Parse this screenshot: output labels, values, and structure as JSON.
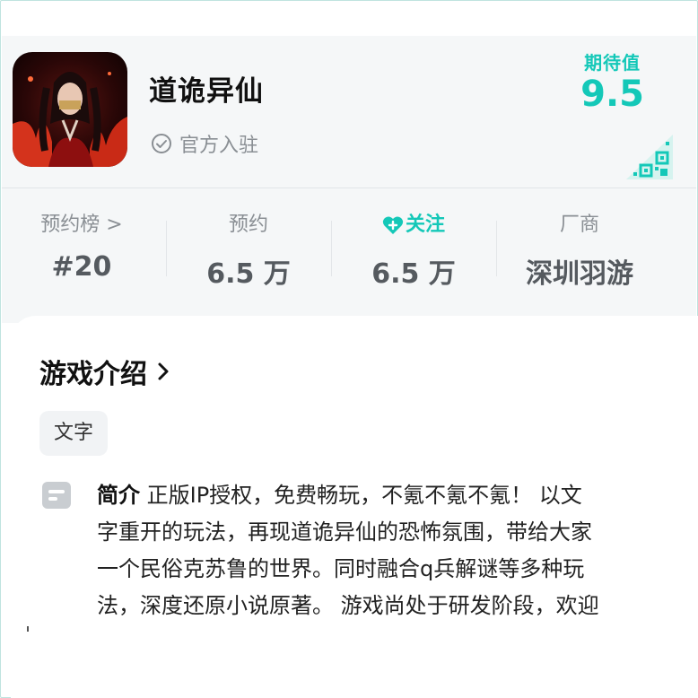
{
  "app": {
    "title": "道诡异仙",
    "official_label": "官方入驻",
    "expectation_label": "期待值",
    "expectation_value": "9.5"
  },
  "stats": [
    {
      "label": "预约榜 >",
      "value": "#20"
    },
    {
      "label": "预约",
      "value": "6.5 万"
    },
    {
      "label": "关注",
      "value": "6.5 万"
    },
    {
      "label": "厂商",
      "value": "深圳羽游"
    }
  ],
  "intro": {
    "section_title": "游戏介绍",
    "tag": "文字",
    "summary_heading": "简介",
    "summary_lines": [
      " 正版IP授权，免费畅玩，不氪不氪不氪！ 以文",
      "字重开的玩法，再现道诡异仙的恐怖氛围，带给大家",
      "一个民俗克苏鲁的世界。同时融合q兵解谜等多种玩",
      "法，深度还原小说原著。 游戏尚处于研发阶段，欢迎"
    ]
  },
  "colors": {
    "accent": "#14c8b8",
    "muted_text": "#8a8f94",
    "header_bg": "#f5f7f8"
  },
  "icons": [
    "check-circle-icon",
    "qr-code-icon",
    "heart-plus-icon",
    "chevron-right-icon",
    "document-icon"
  ]
}
